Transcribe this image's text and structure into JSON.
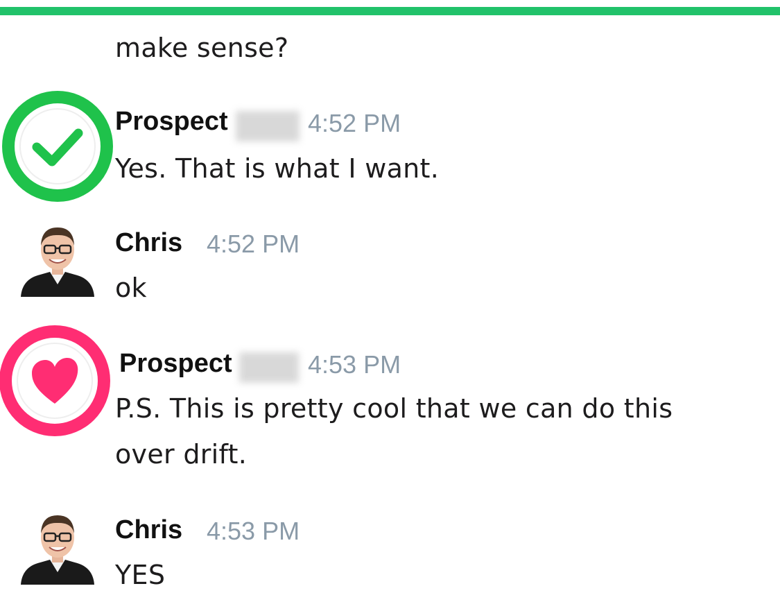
{
  "colors": {
    "top_bar": "#21c26a",
    "check_badge": "#1fc24b",
    "heart_badge": "#ff2d73",
    "timestamp": "#8a9aa8"
  },
  "messages": [
    {
      "text": "make sense?"
    },
    {
      "sender": "Prospect",
      "badge_icon": "checkmark-circle-icon",
      "time": "4:52 PM",
      "text": "Yes. That is what I want."
    },
    {
      "sender": "Chris",
      "avatar": "avatar-chris",
      "time": "4:52 PM",
      "text": "ok"
    },
    {
      "sender": "Prospect",
      "badge_icon": "heart-circle-icon",
      "time": "4:53 PM",
      "text_line1": "P.S. This is pretty cool that we can do this",
      "text_line2": "over drift."
    },
    {
      "sender": "Chris",
      "avatar": "avatar-chris",
      "time": "4:53 PM",
      "text": "YES"
    }
  ]
}
